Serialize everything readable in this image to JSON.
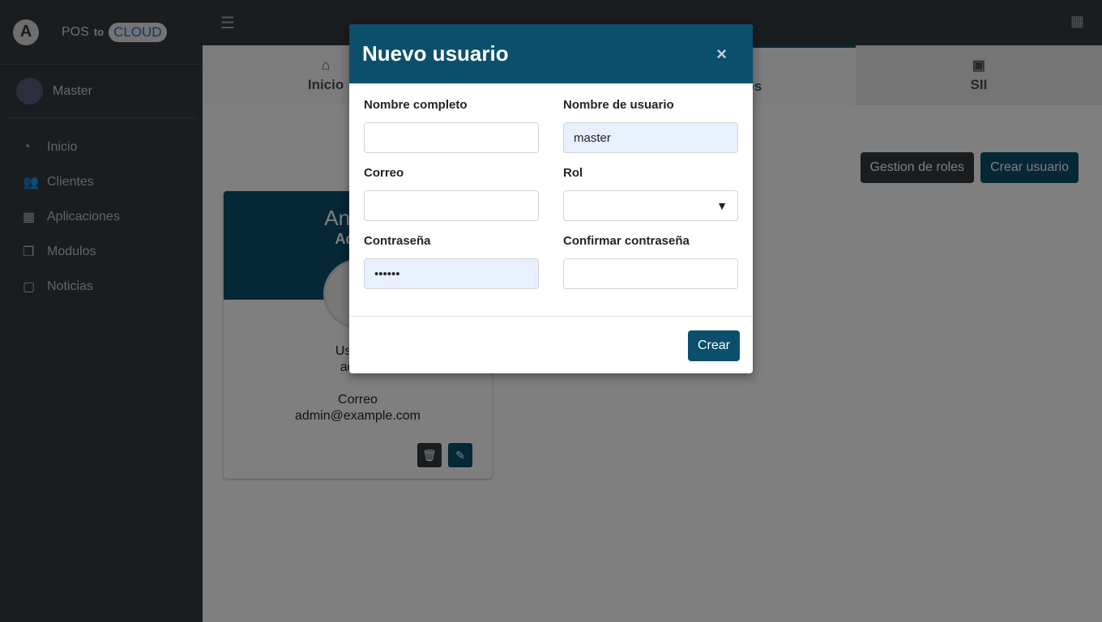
{
  "brand": {
    "pos": "POS",
    "to": "to",
    "cloud": "CLOUD"
  },
  "user": {
    "name": "Master"
  },
  "sidebar": {
    "items": [
      {
        "label": "Inicio",
        "icon": "dashboard-icon"
      },
      {
        "label": "Clientes",
        "icon": "users-icon"
      },
      {
        "label": "Aplicaciones",
        "icon": "grid-icon"
      },
      {
        "label": "Modulos",
        "icon": "copy-icon"
      },
      {
        "label": "Noticias",
        "icon": "comment-icon"
      }
    ]
  },
  "tabs": [
    {
      "label": "Inicio",
      "icon": "home-icon"
    },
    {
      "label": "Usuarios",
      "icon": "users-icon"
    },
    {
      "label": "SII",
      "icon": "box-icon"
    }
  ],
  "actions": {
    "roles": "Gestion de roles",
    "create": "Crear usuario"
  },
  "card": {
    "name": "Andres",
    "role": "Admin",
    "user_label": "Usuario",
    "user_value": "admin",
    "email_label": "Correo",
    "email_value": "admin@example.com"
  },
  "modal": {
    "title": "Nuevo usuario",
    "close": "×",
    "fields": {
      "fullname": {
        "label": "Nombre completo",
        "value": ""
      },
      "username": {
        "label": "Nombre de usuario",
        "value": "master"
      },
      "email": {
        "label": "Correo",
        "value": ""
      },
      "role": {
        "label": "Rol",
        "value": ""
      },
      "password": {
        "label": "Contraseña",
        "value": "••••••"
      },
      "confirm": {
        "label": "Confirmar contraseña",
        "value": ""
      }
    },
    "submit": "Crear"
  },
  "colors": {
    "primary": "#0b4f6c",
    "sidebar": "#343a40"
  }
}
